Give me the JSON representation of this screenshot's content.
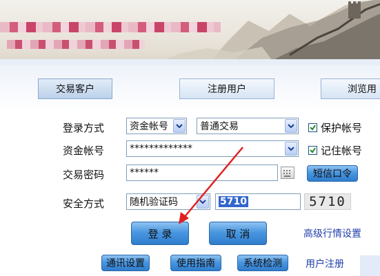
{
  "tabs": [
    {
      "label": "交易客户",
      "active": true
    },
    {
      "label": "注册用户",
      "active": false
    },
    {
      "label": "浏览用",
      "active": false
    }
  ],
  "form": {
    "login_method_label": "登录方式",
    "account_type_value": "资金帐号",
    "trade_type_value": "普通交易",
    "protect_account_label": "保护帐号",
    "protect_account_checked": true,
    "fund_account_label": "资金帐号",
    "fund_account_value": "*************",
    "remember_account_label": "记住帐号",
    "remember_account_checked": true,
    "password_label": "交易密码",
    "password_value": "******",
    "sms_token_label": "短信口令",
    "security_label": "安全方式",
    "security_value": "随机验证码",
    "captcha_input_value": "5710",
    "captcha_image_text": "5710"
  },
  "actions": {
    "login_label": "登 录",
    "cancel_label": "取 消",
    "advanced_settings_label": "高级行情设置"
  },
  "footer": {
    "comm_settings_label": "通讯设置",
    "user_guide_label": "使用指南",
    "system_check_label": "系统检测",
    "user_register_label": "用户注册"
  },
  "colors": {
    "accent_blue": "#3d8be0",
    "link": "#1f3ea8",
    "arrow": "#e02020"
  }
}
